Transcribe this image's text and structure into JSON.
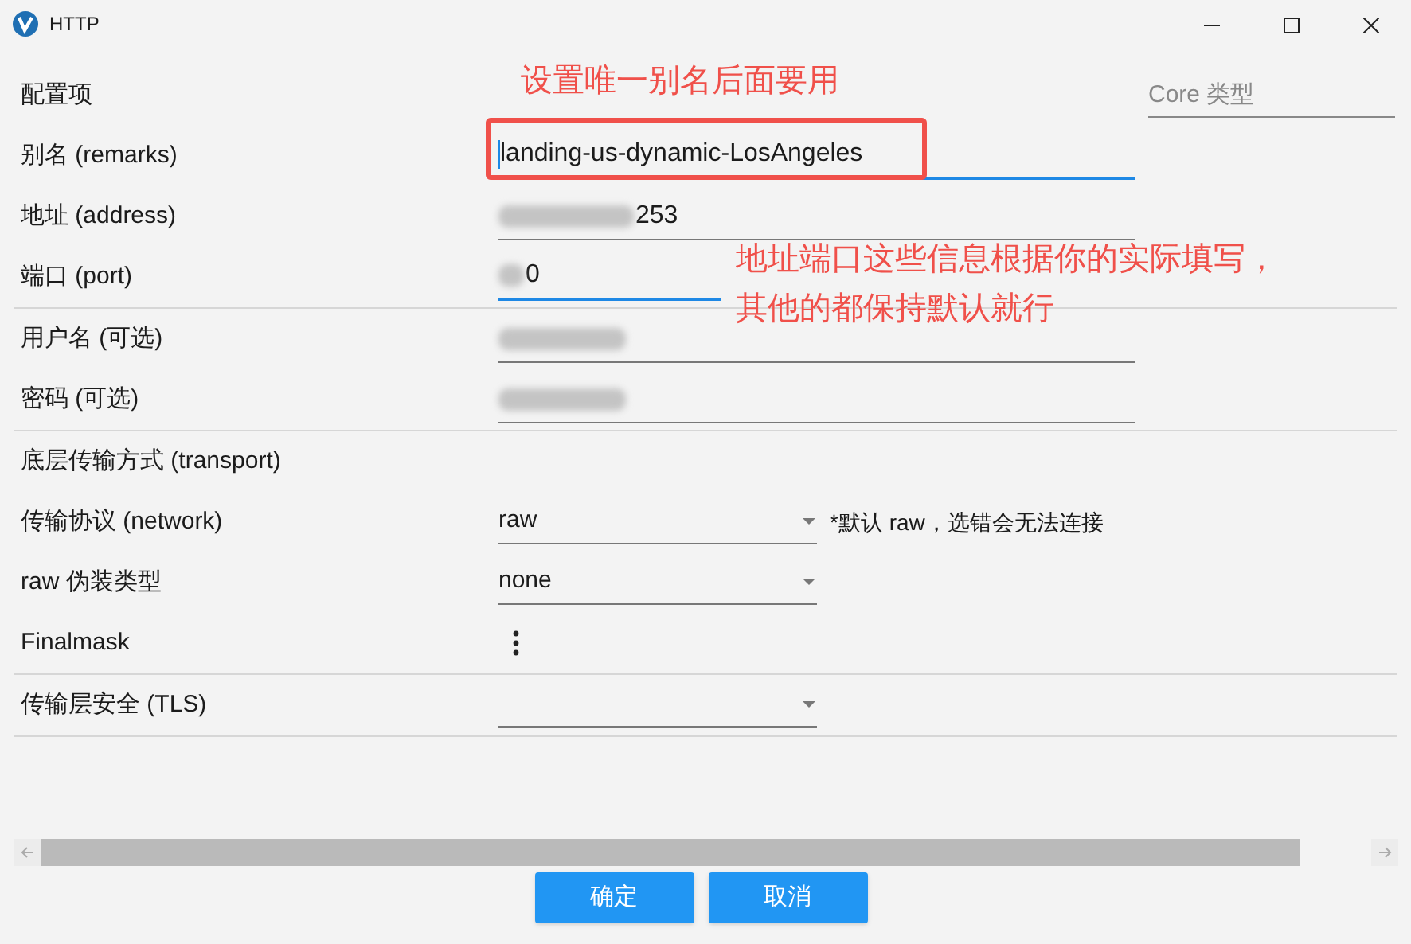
{
  "window": {
    "title": "HTTP"
  },
  "rows": [
    {
      "kind": "heading",
      "label": "配置项"
    },
    {
      "kind": "text",
      "label": "别名 (remarks)",
      "value": "landing-us-dynamic-LosAngeles",
      "focused": true,
      "blurred": false
    },
    {
      "kind": "text",
      "label": "地址 (address)",
      "value": "253",
      "focused": false,
      "blurred": true
    },
    {
      "kind": "text",
      "label": "端口 (port)",
      "value": "0",
      "focused": true,
      "blurred": true
    },
    {
      "kind": "divider"
    },
    {
      "kind": "text",
      "label": "用户名 (可选)",
      "focused": false,
      "blurred": true
    },
    {
      "kind": "text",
      "label": "密码 (可选)",
      "focused": false,
      "blurred": true
    },
    {
      "kind": "divider"
    },
    {
      "kind": "heading",
      "label": "底层传输方式 (transport)"
    },
    {
      "kind": "select",
      "label": "传输协议 (network)",
      "value": "raw",
      "note": "*默认 raw，选错会无法连接"
    },
    {
      "kind": "select",
      "label": "raw 伪装类型",
      "value": "none"
    },
    {
      "kind": "menu",
      "label": "Finalmask"
    },
    {
      "kind": "divider"
    },
    {
      "kind": "select",
      "label": "传输层安全 (TLS)"
    },
    {
      "kind": "divider"
    }
  ],
  "core_type": {
    "placeholder": "Core 类型"
  },
  "annotations": [
    {
      "text": "设置唯一别名后面要用"
    },
    {
      "lines": [
        "地址端口这些信息根据你的实际填写，",
        "其他的都保持默认就行"
      ]
    }
  ],
  "buttons": [
    "确定",
    "取消"
  ]
}
